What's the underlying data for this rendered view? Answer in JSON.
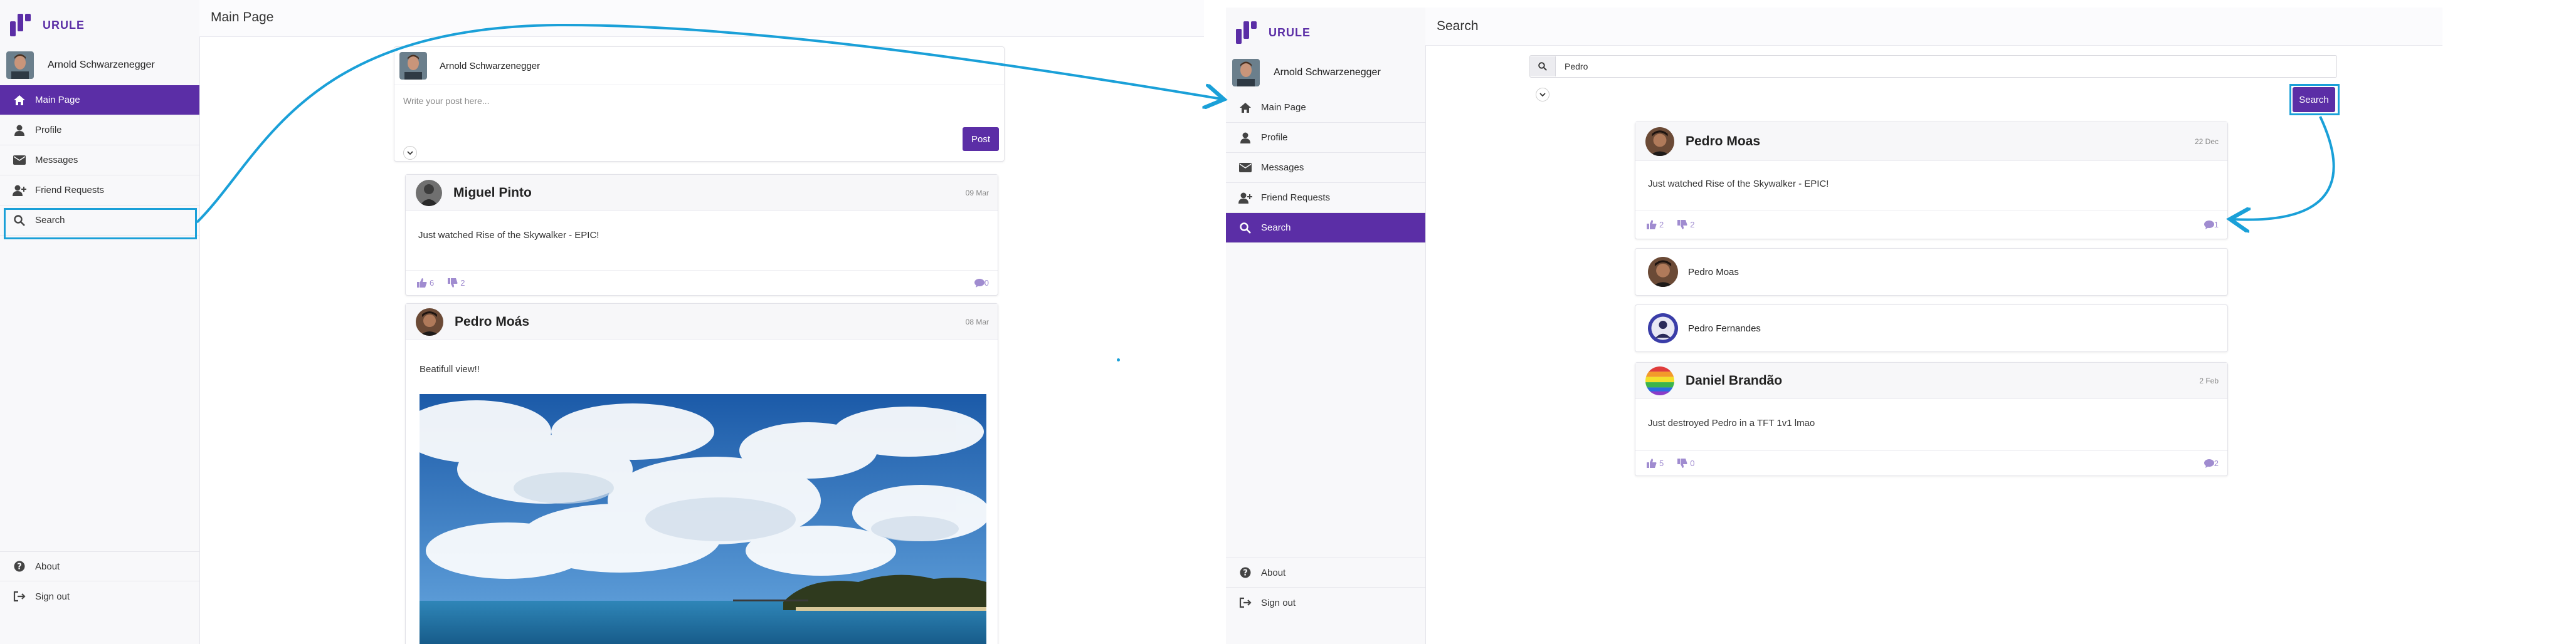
{
  "brand": {
    "name": "URULE"
  },
  "user": {
    "name": "Arnold Schwarzenegger"
  },
  "nav": {
    "items": [
      "Main Page",
      "Profile",
      "Messages",
      "Friend Requests",
      "Search"
    ],
    "bottom": [
      "About",
      "Sign out"
    ]
  },
  "left": {
    "page_title": "Main Page",
    "composer": {
      "placeholder": "Write your post here...",
      "post_label": "Post"
    },
    "posts": [
      {
        "author": "Miguel Pinto",
        "date": "09 Mar",
        "text": "Just watched Rise of the Skywalker - EPIC!",
        "likes": "6",
        "dislikes": "2",
        "comments": "0"
      },
      {
        "author": "Pedro Moás",
        "date": "08 Mar",
        "text": "Beatifull view!!"
      }
    ]
  },
  "right": {
    "page_title": "Search",
    "search": {
      "value": "Pedro",
      "button_label": "Search"
    },
    "results": {
      "post1": {
        "author": "Pedro Moas",
        "date": "22 Dec",
        "text": "Just watched Rise of the Skywalker - EPIC!",
        "likes": "2",
        "dislikes": "2",
        "comments": "1"
      },
      "users": [
        "Pedro Moas",
        "Pedro Fernandes"
      ],
      "post2": {
        "author": "Daniel Brandão",
        "date": "2 Feb",
        "text": "Just destroyed Pedro in a TFT 1v1 lmao",
        "likes": "5",
        "dislikes": "0",
        "comments": "2"
      }
    }
  },
  "colors": {
    "accent": "#5b2ea6",
    "annotation": "#1aa0d8"
  }
}
